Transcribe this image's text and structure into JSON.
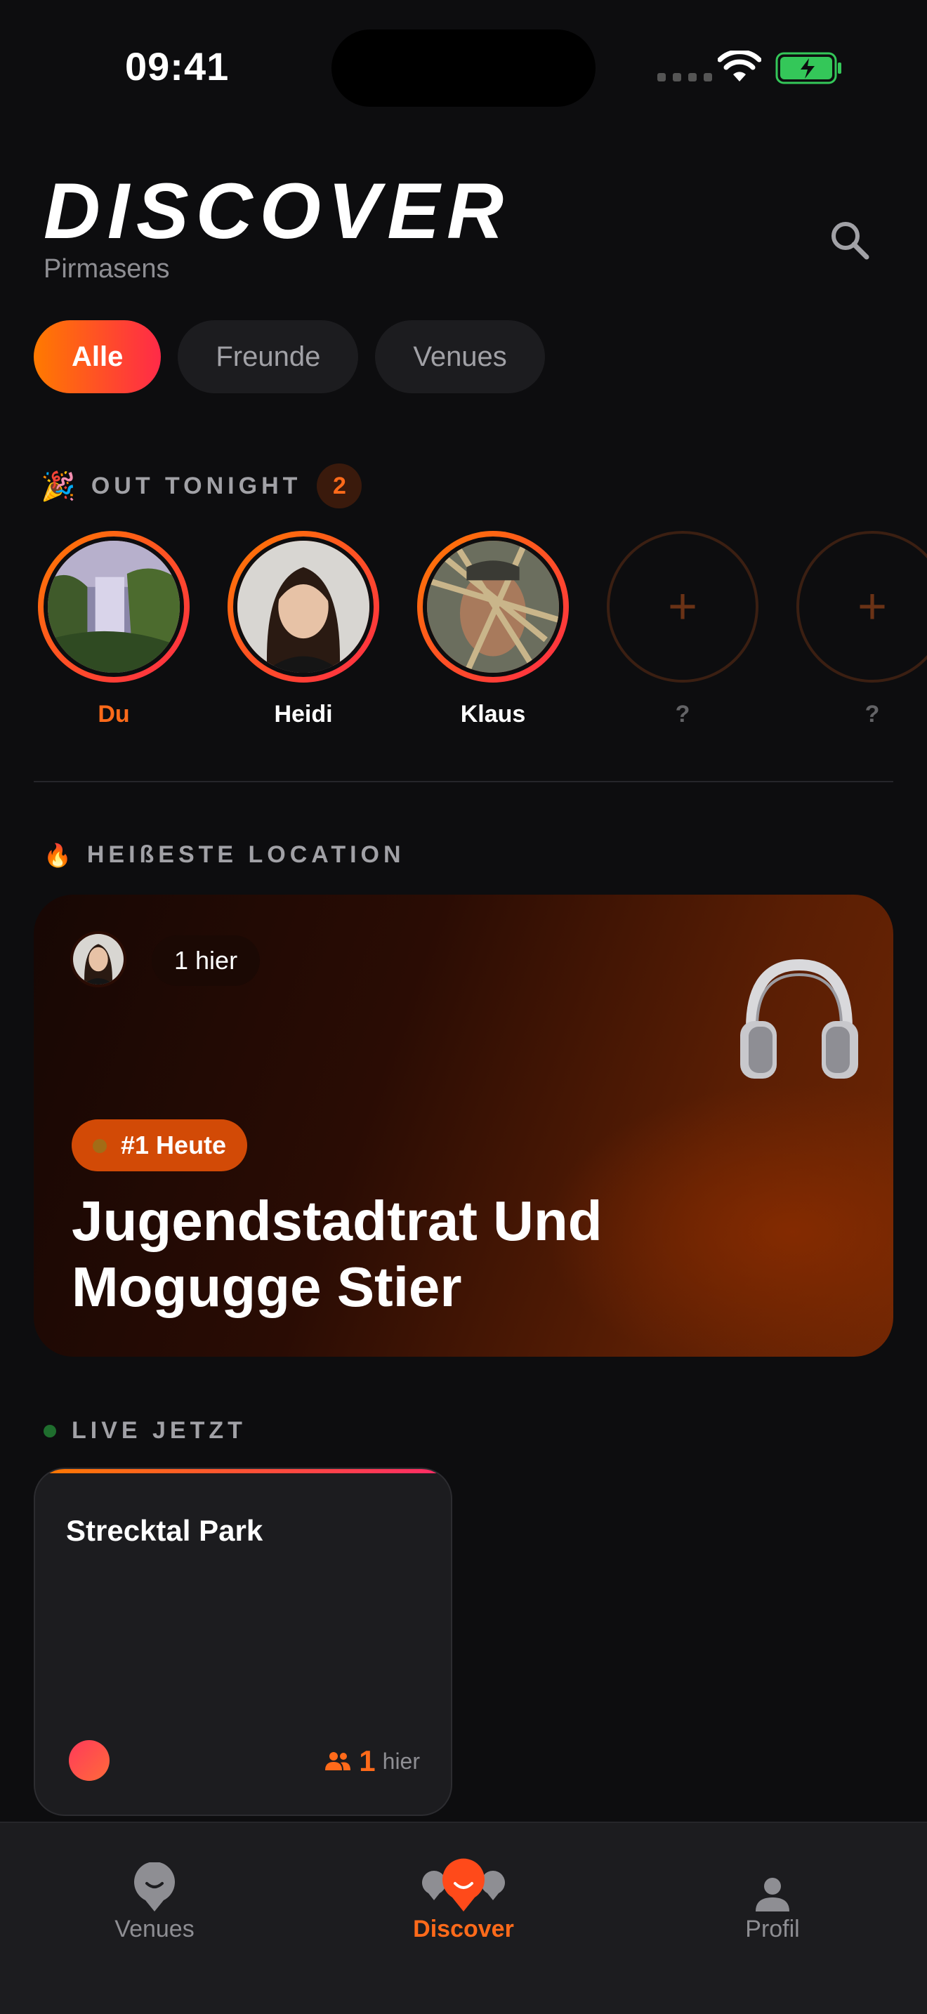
{
  "status": {
    "time": "09:41"
  },
  "header": {
    "title": "DISCOVER",
    "city": "Pirmasens"
  },
  "filters": [
    {
      "label": "Alle",
      "active": true
    },
    {
      "label": "Freunde",
      "active": false
    },
    {
      "label": "Venues",
      "active": false
    }
  ],
  "out_tonight": {
    "emoji": "🎉",
    "title": "OUT TONIGHT",
    "count": "2",
    "friends": [
      {
        "name": "Du",
        "photo": "waterfall"
      },
      {
        "name": "Heidi",
        "photo": "woman-portrait"
      },
      {
        "name": "Klaus",
        "photo": "man-palm"
      },
      {
        "name": "?",
        "photo": "empty"
      },
      {
        "name": "?",
        "photo": "empty"
      }
    ]
  },
  "hottest": {
    "emoji": "🔥",
    "title": "HEIßESTE LOCATION",
    "here_text": "1 hier",
    "rank": "#1 Heute",
    "venue_line1": "Jugendstadtrat Und",
    "venue_line2": "Mogugge Stier",
    "icon": "headphones-icon"
  },
  "live": {
    "title": "LIVE JETZT",
    "card": {
      "name": "Strecktal Park",
      "count": "1",
      "count_label": "hier"
    }
  },
  "tabs": [
    {
      "label": "Venues",
      "icon": "venue-pin-icon",
      "active": false
    },
    {
      "label": "Discover",
      "icon": "discover-pins-icon",
      "active": true
    },
    {
      "label": "Profil",
      "icon": "person-icon",
      "active": false
    }
  ],
  "colors": {
    "accent": "#ff6a1a",
    "gradient_start": "#ff7a00",
    "gradient_end": "#ff2a48",
    "background": "#0d0d0f"
  }
}
